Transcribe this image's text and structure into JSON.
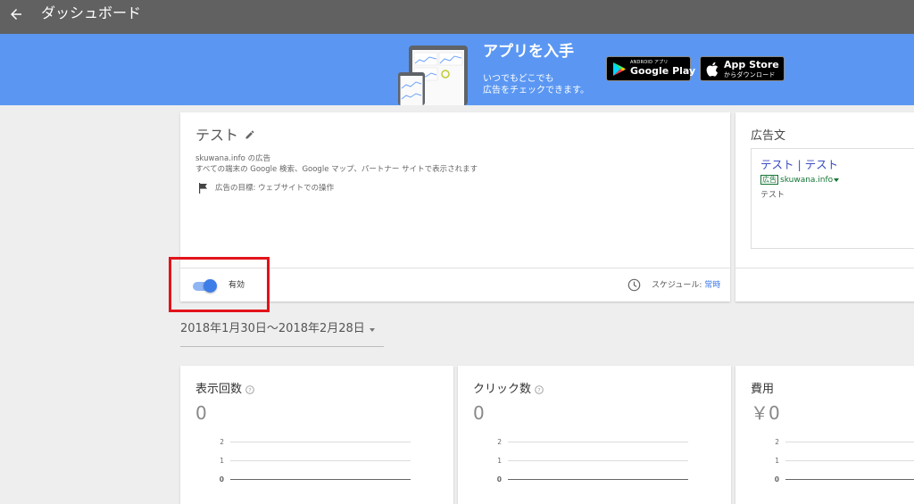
{
  "topbar": {
    "title": "ダッシュボード"
  },
  "banner": {
    "title": "アプリを入手",
    "subtitle_line1": "いつでもどこでも",
    "subtitle_line2": "広告をチェックできます。",
    "google_play": {
      "small": "ANDROID アプリ",
      "big": "Google Play"
    },
    "app_store": {
      "big": "App Store",
      "small": "からダウンロード"
    }
  },
  "ad_card": {
    "name": "テスト",
    "domain_line": "skuwana.info の広告",
    "description": "すべての端末の Google 検索、Google マップ、パートナー サイトで表示されます",
    "goal": "広告の目標: ウェブサイトでの操作",
    "status_label": "有効",
    "status_on": true,
    "schedule_label": "スケジュール: ",
    "schedule_value": "常時"
  },
  "ad_text_card": {
    "title": "広告文",
    "headline": "テスト | テスト",
    "badge": "広告",
    "url": "skuwana.info",
    "description": "テスト"
  },
  "date_range": "2018年1月30日〜2018年2月28日",
  "metrics": [
    {
      "label": "表示回数",
      "value": "0",
      "help": true
    },
    {
      "label": "クリック数",
      "value": "0",
      "help": true
    },
    {
      "label": "費用",
      "value": "￥0",
      "help": false
    }
  ],
  "axis_ticks": [
    "2",
    "1",
    "0"
  ],
  "colors": {
    "topbar": "#616161",
    "banner": "#5b97f2",
    "accent": "#3d7de8",
    "highlight": "#e3131a",
    "link": "#3c4ec3",
    "url_green": "#137333"
  }
}
